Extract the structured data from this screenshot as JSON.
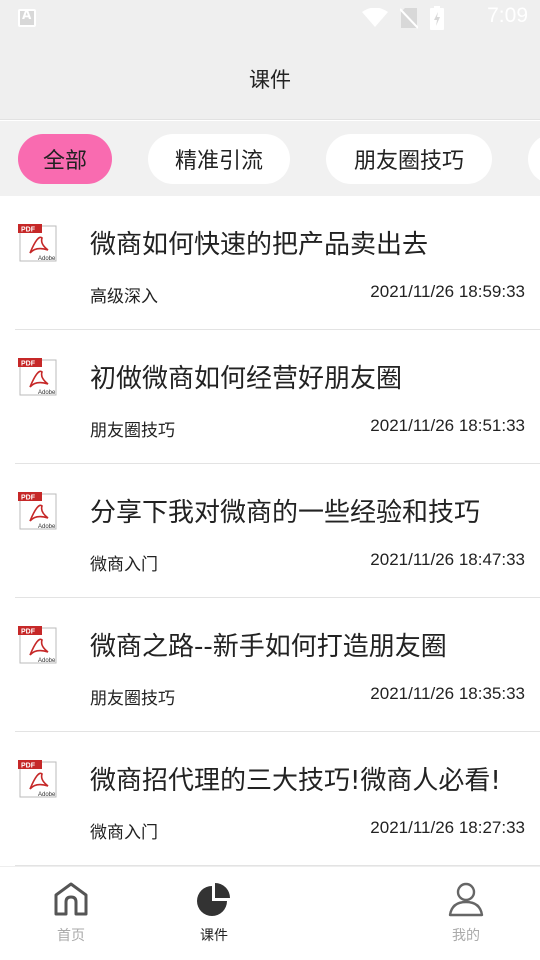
{
  "status_bar": {
    "time": "7:09"
  },
  "header": {
    "title": "课件"
  },
  "tabs": [
    {
      "label": "全部",
      "active": true
    },
    {
      "label": "精准引流",
      "active": false
    },
    {
      "label": "朋友圈技巧",
      "active": false
    }
  ],
  "colors": {
    "accent": "#f96bb0",
    "header_bg": "#efefef",
    "inactive_nav": "#aaaaaa"
  },
  "items": [
    {
      "icon": "pdf-icon",
      "title": "微商如何快速的把产品卖出去",
      "category": "高级深入",
      "time": "2021/11/26 18:59:33"
    },
    {
      "icon": "pdf-icon",
      "title": "初做微商如何经营好朋友圈",
      "category": "朋友圈技巧",
      "time": "2021/11/26 18:51:33"
    },
    {
      "icon": "pdf-icon",
      "title": "分享下我对微商的一些经验和技巧",
      "category": "微商入门",
      "time": "2021/11/26 18:47:33"
    },
    {
      "icon": "pdf-icon",
      "title": "微商之路--新手如何打造朋友圈",
      "category": "朋友圈技巧",
      "time": "2021/11/26 18:35:33"
    },
    {
      "icon": "pdf-icon",
      "title": "微商招代理的三大技巧!微商人必看!",
      "category": "微商入门",
      "time": "2021/11/26 18:27:33"
    }
  ],
  "bottom_nav": [
    {
      "label": "首页",
      "icon": "home-icon",
      "active": false
    },
    {
      "label": "课件",
      "icon": "pie-chart-icon",
      "active": true
    },
    {
      "label": "我的",
      "icon": "user-icon",
      "active": false
    }
  ]
}
